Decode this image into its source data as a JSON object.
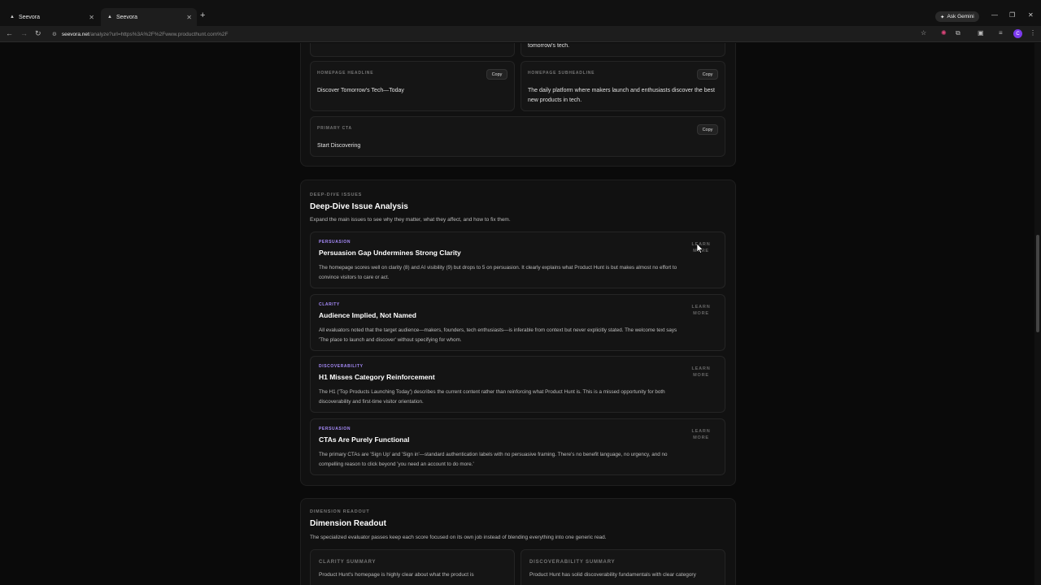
{
  "browser": {
    "tabs": [
      {
        "label": "Seevora",
        "active": false
      },
      {
        "label": "Seevora",
        "active": true
      }
    ],
    "ask_gemini": "Ask Gemini",
    "url_host": "seevora.net",
    "url_path": "/analyze?url=https%3A%2F%2Fwww.producthunt.com%2F",
    "profile_initial": "C"
  },
  "top_fragment_text": "tomorrow's tech.",
  "copy_cards": [
    {
      "label": "HOMEPAGE HEADLINE",
      "copy": "Copy",
      "text": "Discover Tomorrow's Tech—Today"
    },
    {
      "label": "HOMEPAGE SUBHEADLINE",
      "copy": "Copy",
      "text": "The daily platform where makers launch and enthusiasts discover the best new products in tech."
    },
    {
      "label": "PRIMARY CTA",
      "copy": "Copy",
      "text": "Start Discovering"
    }
  ],
  "deep_dive": {
    "label": "DEEP-DIVE ISSUES",
    "title": "Deep-Dive Issue Analysis",
    "desc": "Expand the main issues to see why they matter, what they affect, and how to fix them.",
    "learn_more": "LEARN MORE",
    "issues": [
      {
        "tag": "PERSUASION",
        "title": "Persuasion Gap Undermines Strong Clarity",
        "desc": "The homepage scores well on clarity (8) and AI visibility (9) but drops to 5 on persuasion. It clearly explains what Product Hunt is but makes almost no effort to convince visitors to care or act."
      },
      {
        "tag": "CLARITY",
        "title": "Audience Implied, Not Named",
        "desc": "All evaluators noted that the target audience—makers, founders, tech enthusiasts—is inferable from context but never explicitly stated. The welcome text says 'The place to launch and discover' without specifying for whom."
      },
      {
        "tag": "DISCOVERABILITY",
        "title": "H1 Misses Category Reinforcement",
        "desc": "The H1 ('Top Products Launching Today') describes the current content rather than reinforcing what Product Hunt is. This is a missed opportunity for both discoverability and first-time visitor orientation."
      },
      {
        "tag": "PERSUASION",
        "title": "CTAs Are Purely Functional",
        "desc": "The primary CTAs are 'Sign Up' and 'Sign in'—standard authentication labels with no persuasive framing. There's no benefit language, no urgency, and no compelling reason to click beyond 'you need an account to do more.'"
      }
    ]
  },
  "dimension": {
    "label": "DIMENSION READOUT",
    "title": "Dimension Readout",
    "desc": "The specialized evaluator passes keep each score focused on its own job instead of blending everything into one generic read.",
    "cards": [
      {
        "label": "CLARITY SUMMARY",
        "text": "Product Hunt's homepage is highly clear about what the product is"
      },
      {
        "label": "DISCOVERABILITY SUMMARY",
        "text": "Product Hunt has solid discoverability fundamentals with clear category"
      }
    ]
  }
}
